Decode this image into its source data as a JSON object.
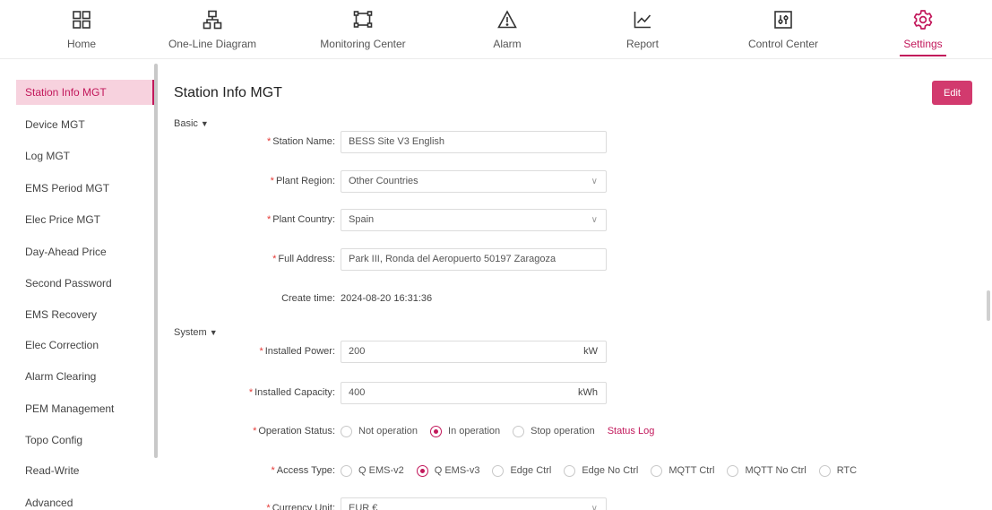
{
  "nav": {
    "items": [
      {
        "label": "Home",
        "icon": "grid-icon"
      },
      {
        "label": "One-Line Diagram",
        "icon": "hierarchy-icon"
      },
      {
        "label": "Monitoring Center",
        "icon": "monitor-icon"
      },
      {
        "label": "Alarm",
        "icon": "warning-icon"
      },
      {
        "label": "Report",
        "icon": "line-chart-icon"
      },
      {
        "label": "Control Center",
        "icon": "sliders-icon"
      },
      {
        "label": "Settings",
        "icon": "gear-icon"
      }
    ],
    "active": "Settings",
    "accent_color": "#c2185b"
  },
  "sidebar": {
    "items": [
      {
        "label": "Station Info MGT"
      },
      {
        "label": "Device MGT"
      },
      {
        "label": "Log MGT"
      },
      {
        "label": "EMS Period MGT"
      },
      {
        "label": "Elec Price MGT"
      },
      {
        "label": "Day-Ahead Price"
      },
      {
        "label": "Second Password"
      },
      {
        "label": "EMS Recovery"
      },
      {
        "label": "Elec Correction"
      },
      {
        "label": "Alarm Clearing"
      },
      {
        "label": "PEM Management"
      },
      {
        "label": "Topo Config"
      },
      {
        "label": "Read-Write"
      },
      {
        "label": "Advanced"
      }
    ],
    "active": "Station Info MGT"
  },
  "main": {
    "title": "Station Info MGT",
    "edit_label": "Edit",
    "basic": {
      "header": "Basic",
      "station_name": {
        "label": "Station Name",
        "value": "BESS Site V3 English"
      },
      "plant_region": {
        "label": "Plant Region",
        "value": "Other Countries"
      },
      "plant_country": {
        "label": "Plant Country",
        "value": "Spain"
      },
      "full_address": {
        "label": "Full Address",
        "value": "Park III, Ronda del Aeropuerto 50197 Zaragoza"
      },
      "create_time": {
        "label": "Create time",
        "value": "2024-08-20 16:31:36"
      }
    },
    "system": {
      "header": "System",
      "installed_power": {
        "label": "Installed Power",
        "value": "200",
        "unit": "kW"
      },
      "installed_capacity": {
        "label": "Installed Capacity",
        "value": "400",
        "unit": "kWh"
      },
      "operation_status": {
        "label": "Operation Status",
        "options": [
          "Not operation",
          "In operation",
          "Stop operation"
        ],
        "selected": "In operation",
        "link": "Status Log"
      },
      "access_type": {
        "label": "Access Type",
        "options": [
          "Q EMS-v2",
          "Q EMS-v3",
          "Edge Ctrl",
          "Edge No Ctrl",
          "MQTT Ctrl",
          "MQTT No Ctrl",
          "RTC"
        ],
        "selected": "Q EMS-v3"
      },
      "currency_unit": {
        "label": "Currency Unit",
        "value": "EUR €"
      }
    }
  }
}
